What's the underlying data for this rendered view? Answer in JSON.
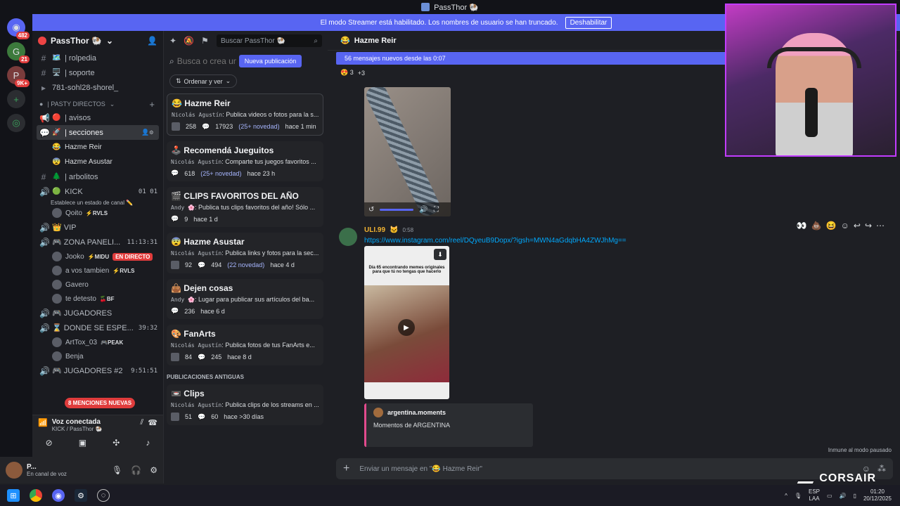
{
  "titlebar": {
    "title": "PassThor 🐏"
  },
  "banner": {
    "text": "El modo Streamer está habilitado. Los nombres de usuario se han truncado.",
    "button": "Deshabilitar"
  },
  "servers": {
    "badges": [
      "482",
      "21",
      "9K+"
    ]
  },
  "guild": {
    "name": "PassThor 🐏"
  },
  "channels": [
    {
      "icon": "#",
      "emoji": "🗺️",
      "name": "| rolpedia"
    },
    {
      "icon": "#",
      "emoji": "🖥️",
      "name": "| soporte"
    },
    {
      "icon": "▸",
      "emoji": "",
      "name": "781-sohl28-shorel_"
    }
  ],
  "category": {
    "name": "| PASTY DIRECTOS"
  },
  "channels2": [
    {
      "icon": "📢",
      "emoji": "🔴",
      "name": "| avisos"
    },
    {
      "icon": "💬",
      "emoji": "🚀",
      "name": "| secciones"
    }
  ],
  "subchannels": [
    {
      "emoji": "😂",
      "name": "Hazme Reir"
    },
    {
      "emoji": "😨",
      "name": "Hazme Asustar"
    }
  ],
  "channel_arbolitos": {
    "icon": "#",
    "emoji": "🌲",
    "name": "| arbolitos"
  },
  "voice_kick": {
    "name": "KICK",
    "counts": "01  01",
    "status": "Establece un estado de canal ✏️",
    "user": "Qoito",
    "tag": "⚡RVLS"
  },
  "voice_vip": {
    "name": "👑 VIP"
  },
  "voice_panel": {
    "name": "🎮 ZONA PANELI...",
    "time": "11:13:31",
    "users": [
      {
        "name": "Jooko",
        "tag": "⚡MIDU",
        "live": "EN DIRECTO"
      },
      {
        "name": "a vos tambien",
        "tag": "⚡RVLS"
      },
      {
        "name": "Gavero",
        "tag": ""
      },
      {
        "name": "te detesto",
        "tag": "🍒BF"
      }
    ]
  },
  "voice_jug": {
    "name": "🎮 JUGADORES"
  },
  "voice_donde": {
    "name": "⌛ DONDE SE ESPE...",
    "time": "39:32",
    "users": [
      {
        "name": "ArtTox_03",
        "tag": "🎮PEAK"
      },
      {
        "name": "Benja",
        "tag": ""
      }
    ]
  },
  "voice_jug2": {
    "name": "🎮 JUGADORES #2",
    "time": "9:51:51"
  },
  "mentions": "8 MENCIONES NUEVAS",
  "voicebar": {
    "title": "Voz conectada",
    "sub": "KICK / PassThor 🐏"
  },
  "userbar": {
    "name": "P...",
    "status": "En canal de voz"
  },
  "forum": {
    "search": "Buscar PassThor 🐏",
    "create_placeholder": "Busca o crea un",
    "new_post": "Nueva publicación",
    "sort": "Ordenar y ver",
    "posts": [
      {
        "emoji": "😂",
        "title": "Hazme Reir",
        "author": "Nicolás Agustín",
        "body": ": Publica videos o fotos para la s...",
        "count": "258",
        "msgs": "17923",
        "nov": "(25+ novedad)",
        "time": "hace 1 min"
      },
      {
        "emoji": "🕹️",
        "title": "Recomendá Jueguitos",
        "author": "Nicolás Agustín",
        "body": ": Comparte tus juegos favoritos ...",
        "count": "",
        "msgs": "618",
        "nov": "(25+ novedad)",
        "time": "hace 23 h"
      },
      {
        "emoji": "🎬",
        "title": "CLIPS FAVORITOS DEL AÑO",
        "author": "Andy 🌸",
        "body": ": Publica tus clips favoritos del año! Sólo ...",
        "count": "9",
        "msgs": "",
        "nov": "",
        "time": "hace 1 d"
      },
      {
        "emoji": "😨",
        "title": "Hazme Asustar",
        "author": "Nicolás Agustín",
        "body": ": Publica links y fotos para la sec...",
        "count": "92",
        "msgs": "494",
        "nov": "(22 novedad)",
        "time": "hace 4 d"
      },
      {
        "emoji": "👜",
        "title": "Dejen cosas",
        "author": "Andy 🌸",
        "body": ": Lugar para publicar sus artículos del ba...",
        "count": "236",
        "msgs": "",
        "nov": "",
        "time": "hace 6 d"
      },
      {
        "emoji": "🎨",
        "title": "FanArts",
        "author": "Nicolás Agustín",
        "body": ": Publica fotos de tus FanArts e...",
        "count": "84",
        "msgs": "245",
        "nov": "",
        "time": "hace 8 d"
      }
    ],
    "old_header": "PUBLICACIONES ANTIGUAS",
    "old_posts": [
      {
        "emoji": "📼",
        "title": "Clips",
        "author": "Nicolás Agustín",
        "body": ": Publica clips de los streams en ...",
        "count": "51",
        "msgs": "60",
        "time": "hace >30 días"
      }
    ]
  },
  "chat": {
    "title": "Hazme Reir",
    "newmsgs": "56 mensajes nuevos desde las 0:07",
    "reaction": {
      "emoji": "😍",
      "count": "3",
      "more": "+3"
    },
    "msg": {
      "author": "ULI.99",
      "badge": "🐱",
      "time": "0:58",
      "link": "https://www.instagram.com/reel/DQyeuB9Dopx/?igsh=MWN4aGdqbHA4ZWJhMg=="
    },
    "video_caption": "Día 65 encontrando memes originales para que tú no tengas que hacerlo",
    "embed": {
      "author": "argentina.moments",
      "desc": "Momentos de ARGENTINA"
    },
    "immune": "Inmune al modo pausado",
    "input_placeholder": "Enviar un mensaje en \"😂 Hazme Reir\""
  },
  "overlay": {
    "brand": "CORSAIR"
  },
  "tray": {
    "lang1": "ESP",
    "lang2": "LAA",
    "time": "01:20",
    "date": "20/12/2025"
  }
}
